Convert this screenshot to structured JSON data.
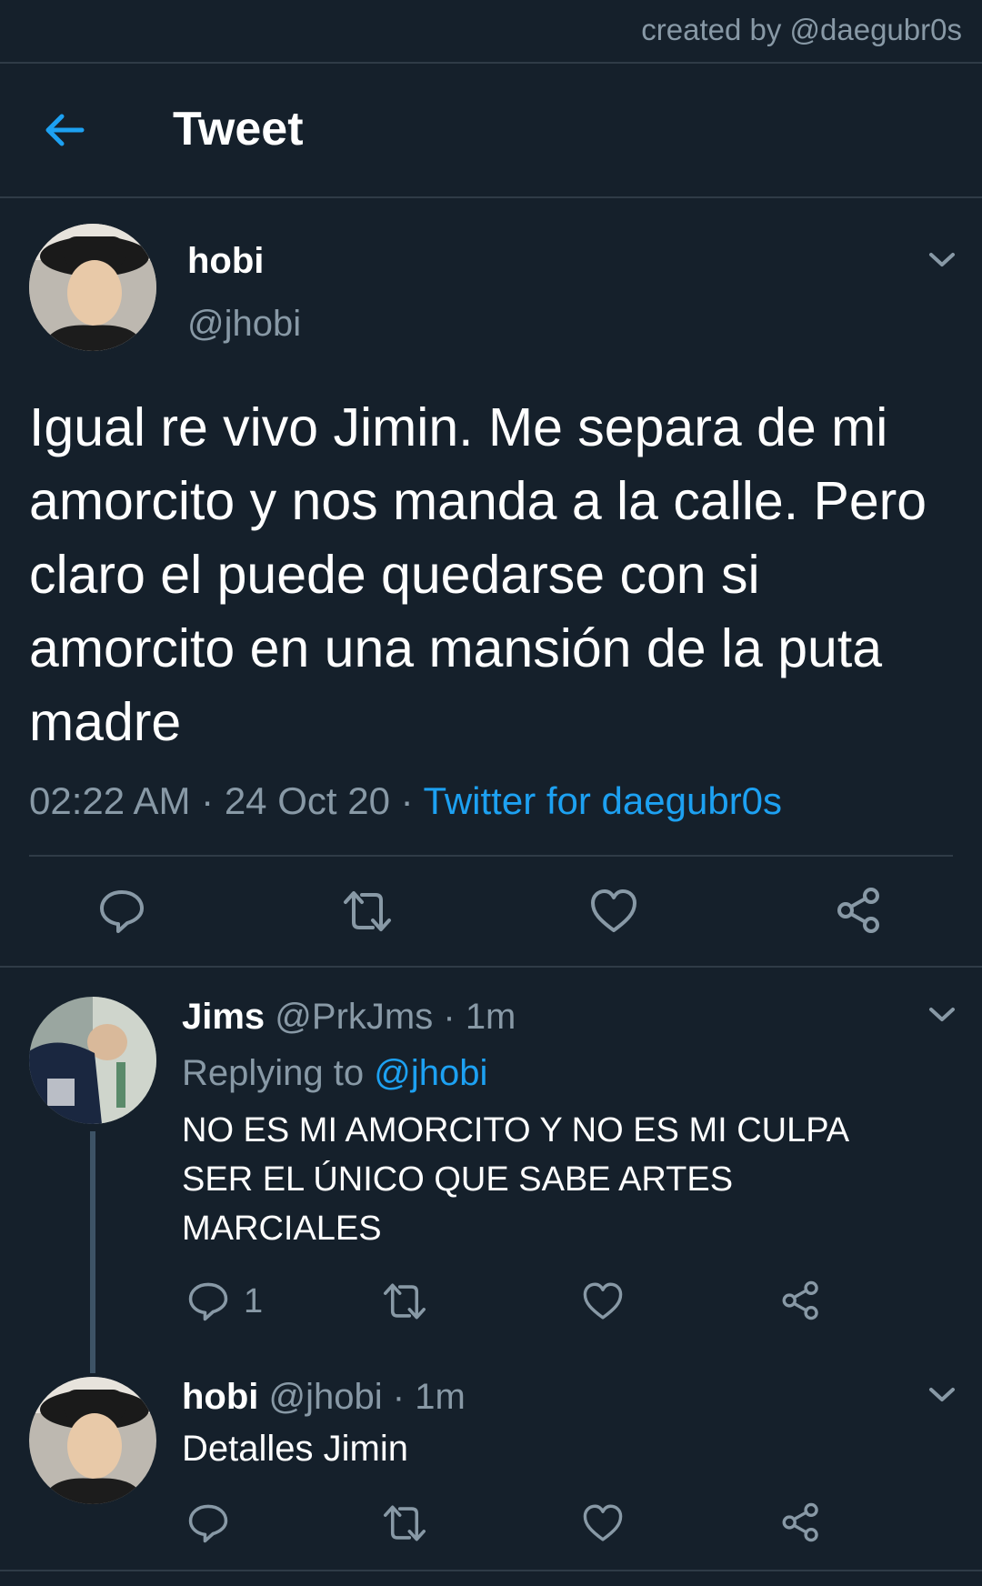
{
  "watermark": "created by @daegubr0s",
  "header": {
    "title": "Tweet",
    "back_icon": "arrow-left-icon"
  },
  "main_tweet": {
    "display_name": "hobi",
    "handle": "@jhobi",
    "text": "Igual re vivo Jimin. Me separa de mi amorcito y nos manda a la calle. Pero claro el puede quedarse con si amorcito en una mansión de la puta madre",
    "time": "02:22 AM",
    "dot": "·",
    "date": "24 Oct 20",
    "source": "Twitter for daegubr0s"
  },
  "reply1": {
    "display_name": "Jims",
    "handle": "@PrkJms",
    "dot": "·",
    "time": "1m",
    "replying_to_label": "Replying to",
    "replying_to_handle": "@jhobi",
    "text": "NO ES MI AMORCITO Y NO ES MI CULPA SER EL ÚNICO QUE SABE ARTES MARCIALES",
    "reply_count": "1"
  },
  "reply2": {
    "display_name": "hobi",
    "handle": "@jhobi",
    "dot": "·",
    "time": "1m",
    "text": "Detalles Jimin"
  },
  "colors": {
    "background": "#15202b",
    "accent": "#1da1f2",
    "muted": "#8899a6",
    "divider": "#2f3b47"
  }
}
